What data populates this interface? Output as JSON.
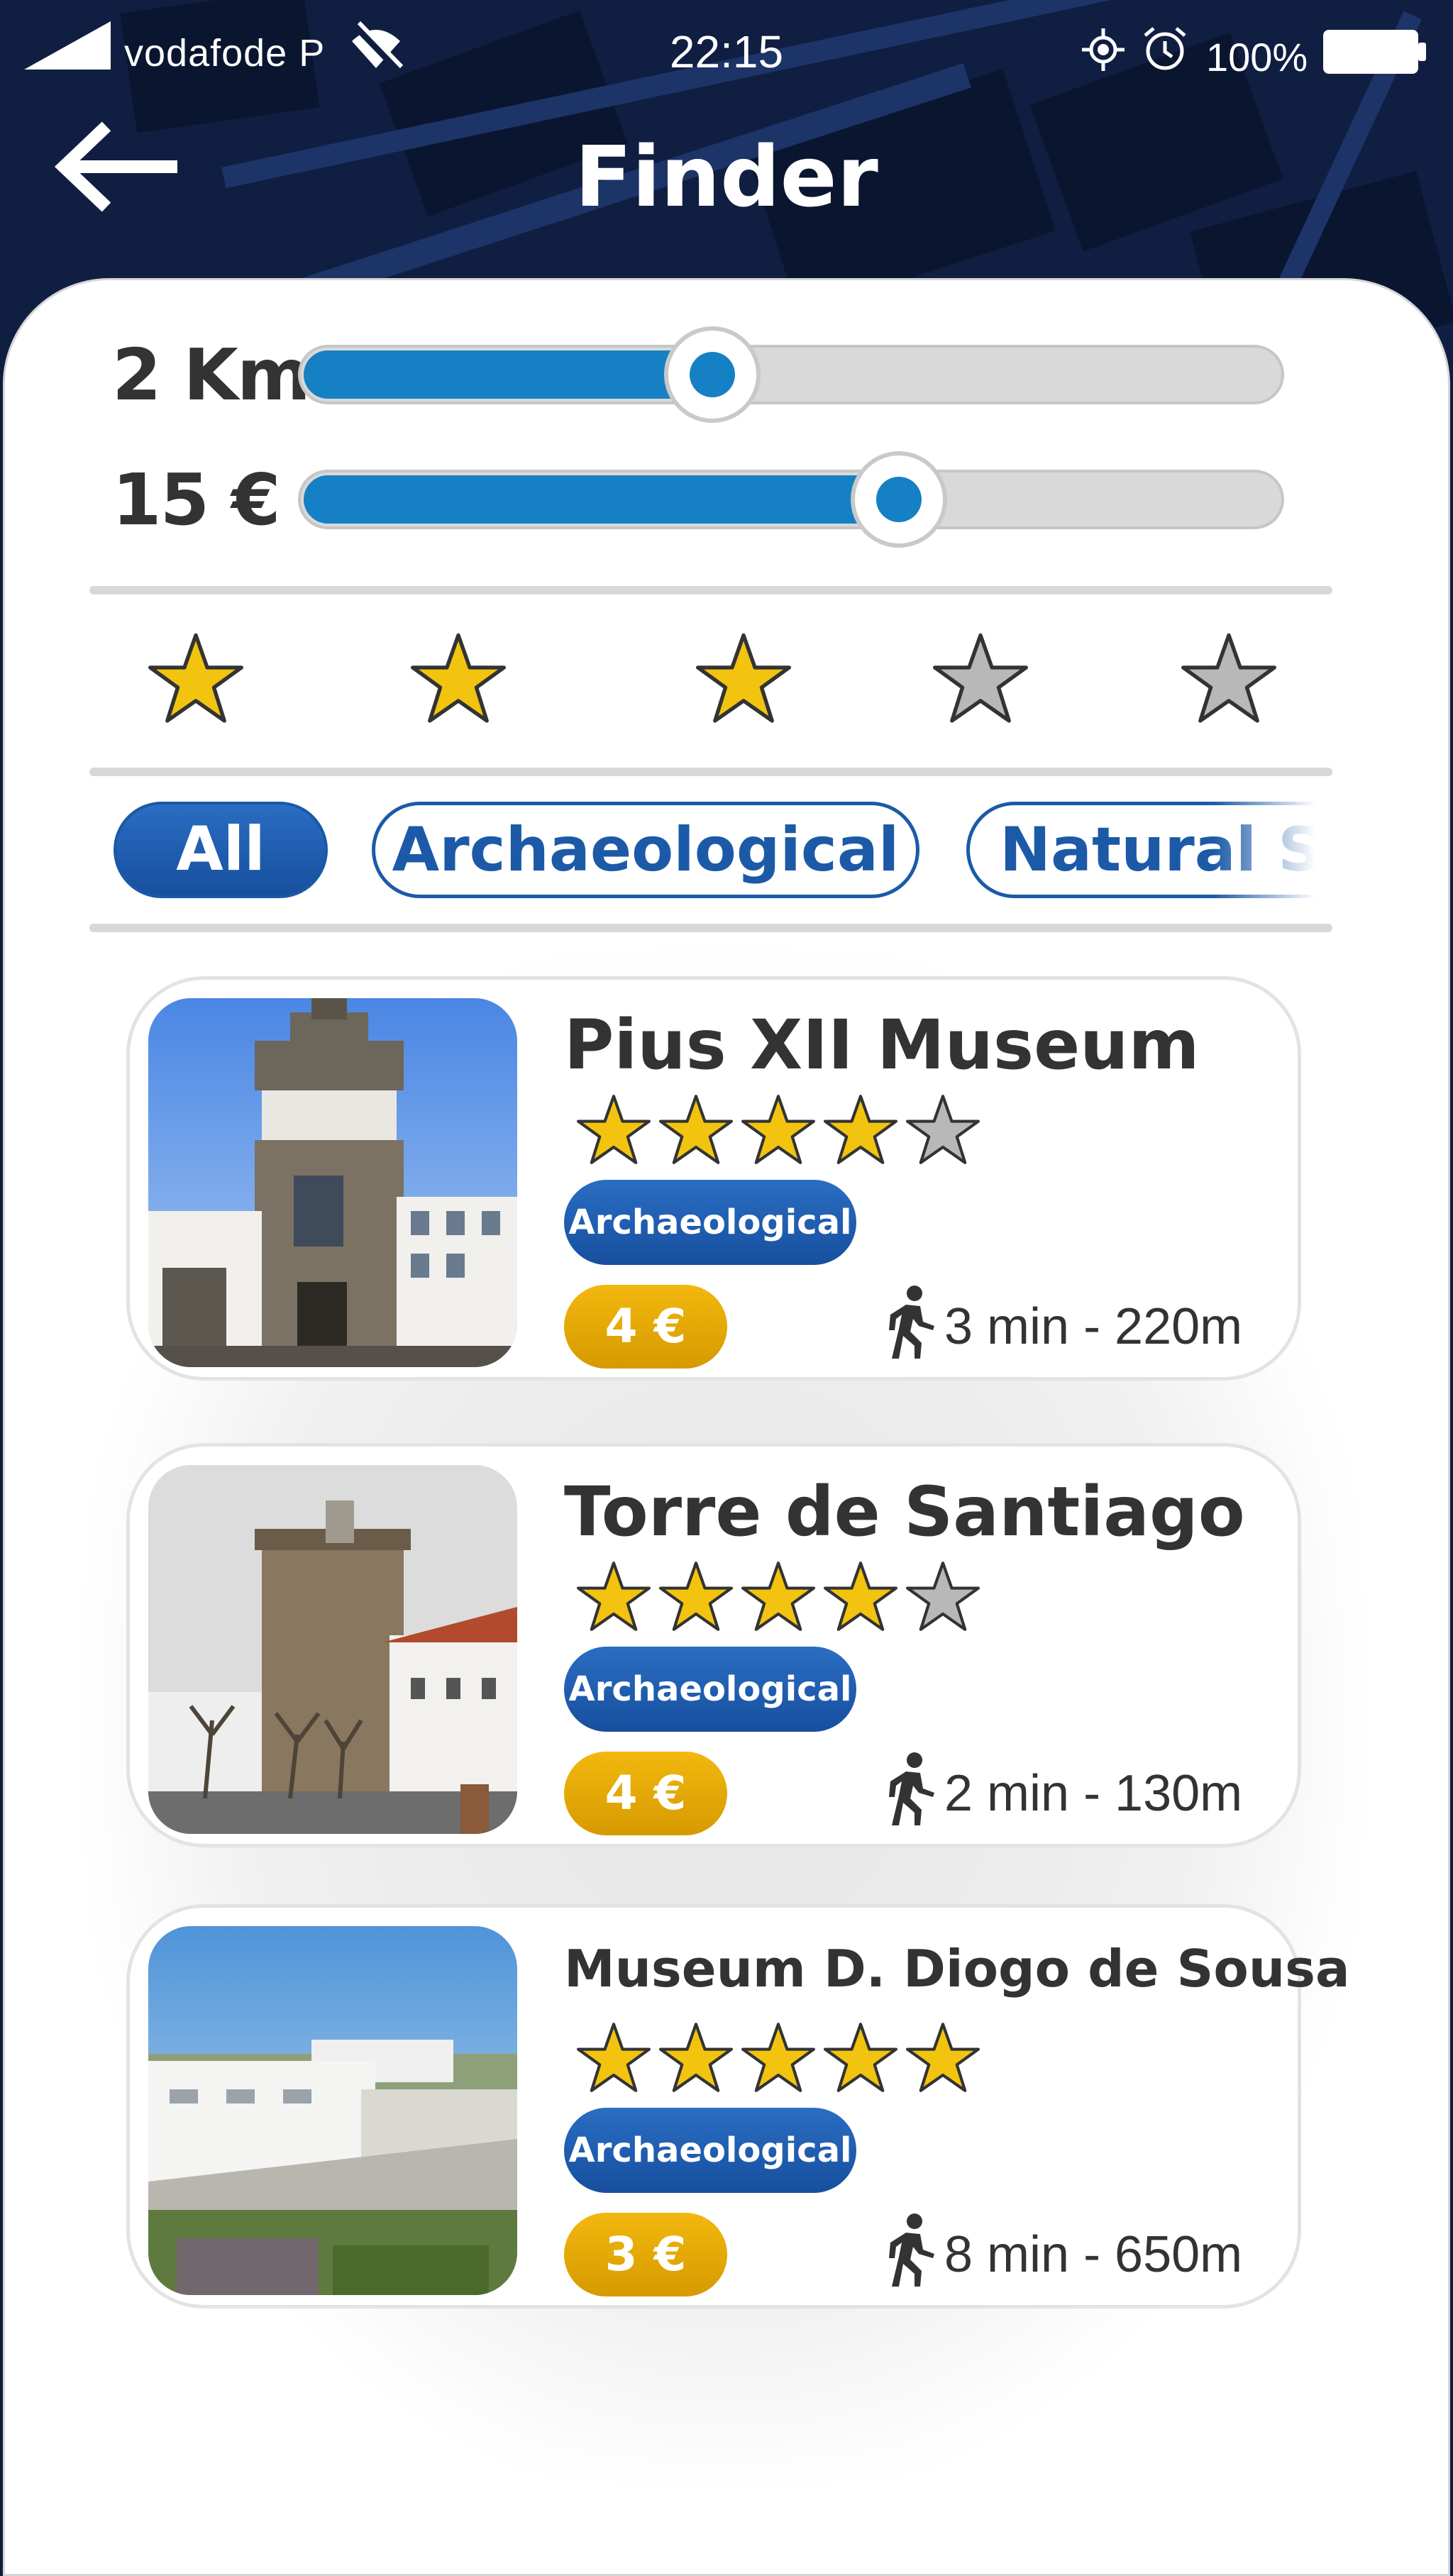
{
  "status_bar": {
    "carrier": "vodafode P",
    "time": "22:15",
    "battery": "100%"
  },
  "header": {
    "title": "Finder",
    "back_icon": "arrow-left-icon"
  },
  "filters": {
    "distance": {
      "label": "2 Km",
      "value_fraction": 0.42
    },
    "price": {
      "label": "15 €",
      "value_fraction": 0.61
    },
    "rating": {
      "selected": 3,
      "max": 5
    },
    "categories": [
      {
        "label": "All",
        "active": true
      },
      {
        "label": "Archaeological",
        "active": false
      },
      {
        "label": "Natural Sci",
        "active": false
      }
    ]
  },
  "results": [
    {
      "title": "Pius XII Museum",
      "rating": 4,
      "category": "Archaeological",
      "price": "4 €",
      "distance": "3 min - 220m"
    },
    {
      "title": "Torre de Santiago",
      "rating": 4,
      "category": "Archaeological",
      "price": "4 €",
      "distance": "2 min - 130m"
    },
    {
      "title": "Museum D. Diogo de Sousa",
      "rating": 5,
      "category": "Archaeological",
      "price": "3 €",
      "distance": "8 min - 650m"
    }
  ],
  "colors": {
    "accent_blue": "#1580c4",
    "badge_blue": "#1c5aa8",
    "star_gold": "#f2c40f",
    "star_gray": "#b8b8b8",
    "price_gold": "#e2a700"
  }
}
